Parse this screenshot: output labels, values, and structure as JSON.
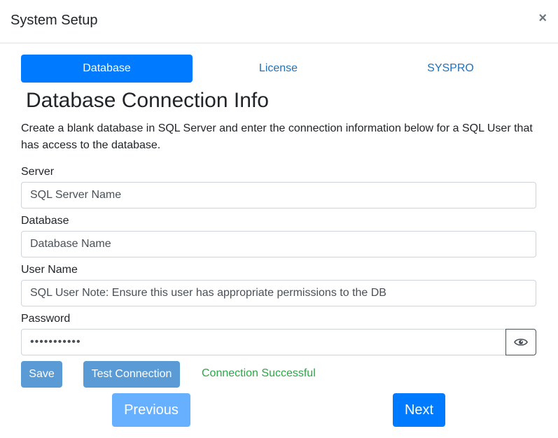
{
  "dialog": {
    "title": "System Setup",
    "close_label": "×"
  },
  "tabs": [
    {
      "label": "Database",
      "active": true
    },
    {
      "label": "License",
      "active": false
    },
    {
      "label": "SYSPRO",
      "active": false
    }
  ],
  "section": {
    "title": "Database Connection Info",
    "description": "Create a blank database in SQL Server and enter the connection information below for a SQL User that has access to the database."
  },
  "form": {
    "server": {
      "label": "Server",
      "value": "SQL Server Name"
    },
    "database": {
      "label": "Database",
      "value": "Database Name"
    },
    "username": {
      "label": "User Name",
      "value": "SQL User Note: Ensure this user has appropriate permissions to the DB"
    },
    "password": {
      "label": "Password",
      "value": "•••••••••••",
      "toggle_icon": "eye-icon"
    }
  },
  "actions": {
    "save_label": "Save",
    "test_label": "Test Connection",
    "status_text": "Connection Successful",
    "status_color": "#28a745"
  },
  "navigation": {
    "previous_label": "Previous",
    "next_label": "Next"
  },
  "colors": {
    "primary": "#007bff",
    "primary_light": "#66b0ff",
    "secondary_button": "#5b9bd5"
  }
}
